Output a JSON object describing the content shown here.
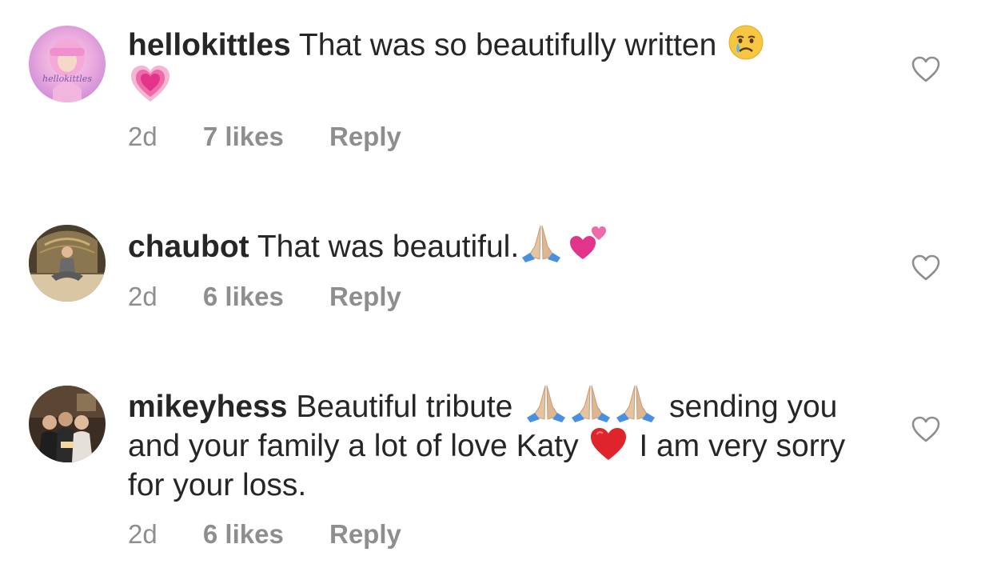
{
  "comments": [
    {
      "username": "hellokittles",
      "text_parts": [
        "That was so beautifully written"
      ],
      "emojis": [
        "crying-face",
        "growing-heart"
      ],
      "time": "2d",
      "likes": "7 likes",
      "reply": "Reply",
      "avatar_text": "hellokittles"
    },
    {
      "username": "chaubot",
      "text_parts": [
        "That was beautiful."
      ],
      "emojis": [
        "folded-hands",
        "two-hearts"
      ],
      "time": "2d",
      "likes": "6 likes",
      "reply": "Reply"
    },
    {
      "username": "mikeyhess",
      "text_parts": [
        "Beautiful tribute",
        "sending you and your family a lot of love Katy",
        "I am very sorry for your loss."
      ],
      "emojis": [
        "folded-hands",
        "folded-hands",
        "folded-hands",
        "red-heart"
      ],
      "time": "2d",
      "likes": "6 likes",
      "reply": "Reply"
    }
  ],
  "colors": {
    "text": "#262626",
    "meta": "#8e8e8e",
    "heart_outline": "#8e8e8e",
    "background": "#ffffff"
  }
}
